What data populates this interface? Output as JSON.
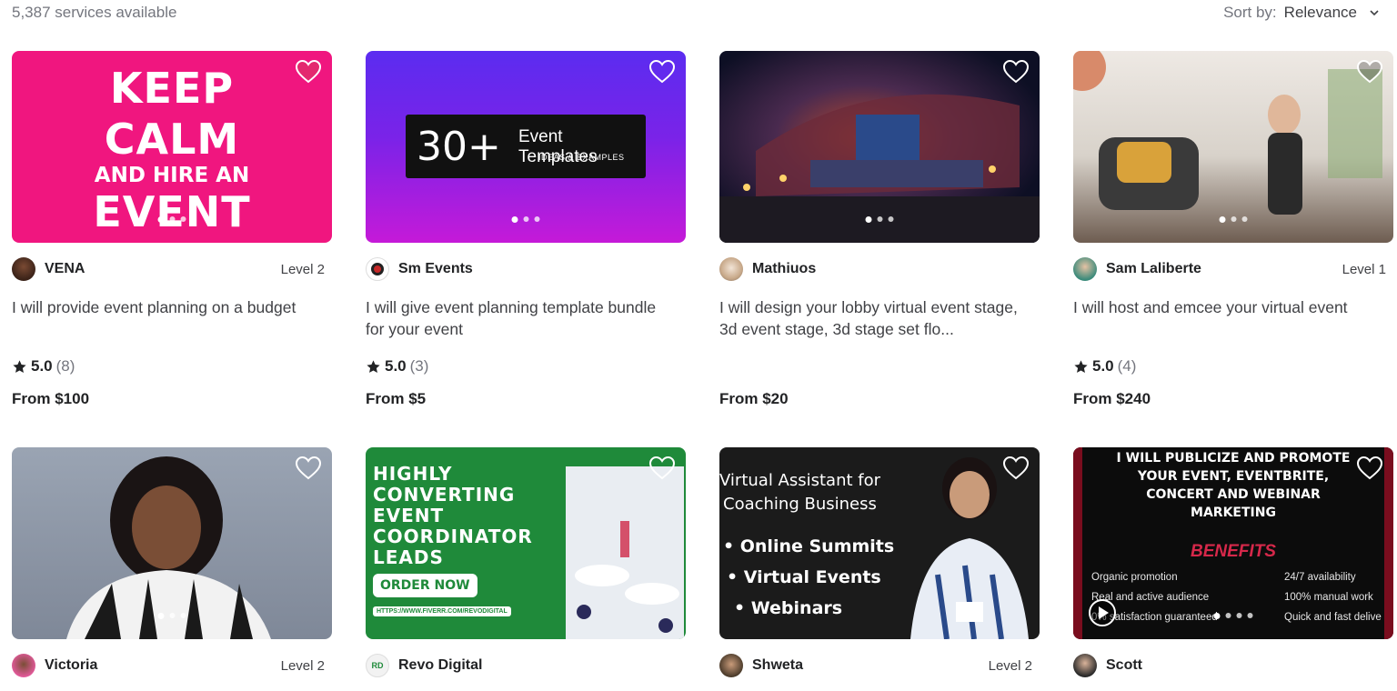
{
  "header": {
    "services_count": "5,387 services available",
    "sort_label": "Sort by:",
    "sort_value": "Relevance"
  },
  "colors": {
    "heart_pink": "#e3296f",
    "star": "#222325",
    "text_primary": "#222325",
    "text_secondary": "#74767e"
  },
  "gigs": [
    {
      "seller": "VENA",
      "level": "Level 2",
      "title": "I will provide event planning on a budget",
      "rating": "5.0",
      "reviews": "(8)",
      "price": "From $100",
      "thumb_text": [
        "KEEP",
        "CALM",
        "AND HIRE AN",
        "EVENT"
      ],
      "favorited": true
    },
    {
      "seller": "Sm Events",
      "level": "",
      "title": "I will give event planning template bundle for your event",
      "rating": "5.0",
      "reviews": "(3)",
      "price": "From $5",
      "thumb_text": [
        "30+",
        "Event Templates",
        "IDEAS & EXAMPLES"
      ],
      "favorited": false
    },
    {
      "seller": "Mathiuos",
      "level": "",
      "title": "I will design your lobby virtual event stage, 3d event stage, 3d stage set flo...",
      "rating": "",
      "reviews": "",
      "price": "From $20",
      "thumb_text": [],
      "favorited": false
    },
    {
      "seller": "Sam Laliberte",
      "level": "Level 1",
      "title": "I will host and emcee your virtual event",
      "rating": "5.0",
      "reviews": "(4)",
      "price": "From $240",
      "thumb_text": [],
      "favorited": false
    },
    {
      "seller": "Victoria",
      "level": "Level 2",
      "title": "",
      "rating": "",
      "reviews": "",
      "price": "",
      "thumb_text": [],
      "favorited": false
    },
    {
      "seller": "Revo Digital",
      "level": "",
      "title": "",
      "rating": "",
      "reviews": "",
      "price": "",
      "thumb_text": [
        "HIGHLY",
        "CONVERTING",
        "EVENT",
        "COORDINATOR",
        "LEADS",
        "ORDER NOW",
        "HTTPS://WWW.FIVERR.COM/REVODIGITAL"
      ],
      "favorited": false
    },
    {
      "seller": "Shweta",
      "level": "Level 2",
      "title": "",
      "rating": "",
      "reviews": "",
      "price": "",
      "thumb_text": [
        "Virtual Assistant for",
        "Coaching Business",
        "• Online Summits",
        "• Virtual Events",
        "• Webinars"
      ],
      "favorited": false
    },
    {
      "seller": "Scott",
      "level": "",
      "title": "",
      "rating": "",
      "reviews": "",
      "price": "",
      "thumb_text": [
        "I WILL PUBLICIZE AND PROMOTE",
        "YOUR EVENT, EVENTBRITE,",
        "CONCERT AND WEBINAR",
        "MARKETING",
        "BENEFITS",
        "Organic promotion",
        "24/7 availability",
        "Real and active audience",
        "100% manual work",
        "0% satisfaction guaranteed",
        "Quick and fast delive"
      ],
      "favorited": false
    }
  ]
}
